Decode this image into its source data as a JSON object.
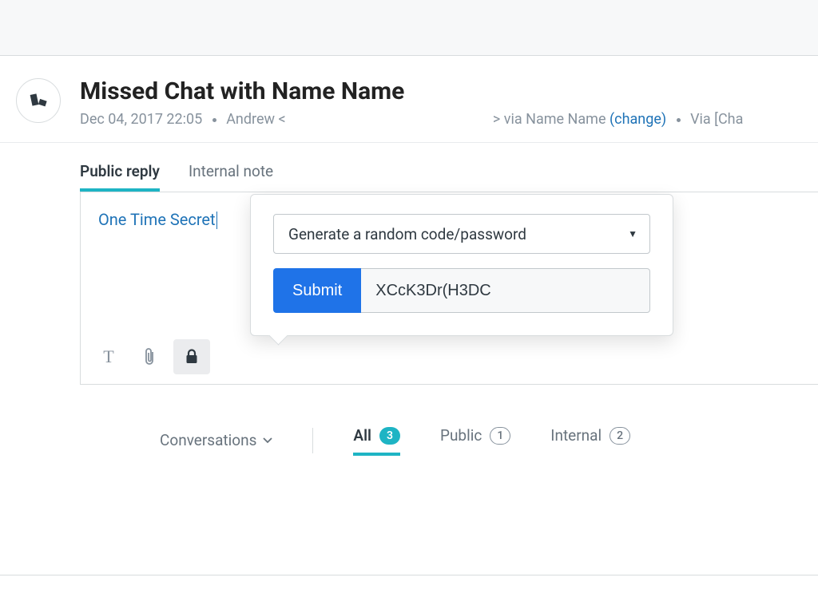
{
  "header": {
    "title": "Missed Chat with Name Name",
    "timestamp": "Dec 04, 2017 22:05",
    "sender_prefix": "Andrew <",
    "sender_mid": "> via Name Name",
    "change_link": "(change)",
    "via_channel": "Via [Cha"
  },
  "reply": {
    "tabs": {
      "public": "Public reply",
      "internal": "Internal note"
    },
    "content_link": "One Time Secret"
  },
  "popover": {
    "select_label": "Generate a random code/password",
    "submit_label": "Submit",
    "code_value": "XCcK3Dr(H3DC"
  },
  "toolbar": {
    "text_icon": "T"
  },
  "footer": {
    "conversations_label": "Conversations",
    "filters": {
      "all": {
        "label": "All",
        "count": "3"
      },
      "public": {
        "label": "Public",
        "count": "1"
      },
      "internal": {
        "label": "Internal",
        "count": "2"
      }
    }
  }
}
